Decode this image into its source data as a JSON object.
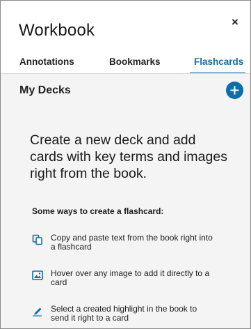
{
  "window": {
    "title": "Workbook",
    "close_label": "×"
  },
  "tabs": [
    {
      "label": "Annotations",
      "active": false
    },
    {
      "label": "Bookmarks",
      "active": false
    },
    {
      "label": "Flashcards",
      "active": true
    }
  ],
  "decks": {
    "title": "My Decks",
    "add_icon": "plus-icon"
  },
  "empty_state": {
    "message": "Create a new deck and add cards with key terms and images right from the book.",
    "ways_heading": "Some ways to create a flashcard:",
    "tips": [
      {
        "icon": "copy-icon",
        "text": "Copy and paste text from the book right into a flashcard"
      },
      {
        "icon": "image-icon",
        "text": "Hover over any image to add it directly to a card"
      },
      {
        "icon": "highlighter-icon",
        "text": "Select a created highlight in the book to send it right to a card"
      }
    ]
  },
  "colors": {
    "accent": "#0d6ea8",
    "body_background": "#f4f4f4",
    "header_background": "#ffffff"
  }
}
